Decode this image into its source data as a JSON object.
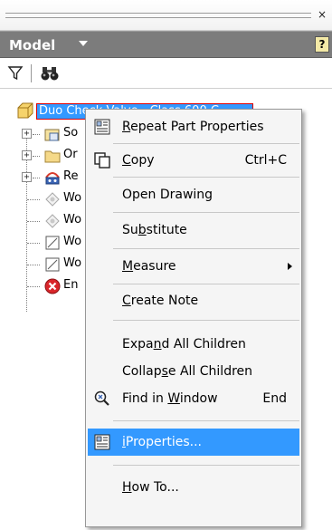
{
  "panel": {
    "close_glyph": "×",
    "title": "Model",
    "help_glyph": "?"
  },
  "toolbar": {
    "filter_icon": "filter-icon",
    "find_icon": "binoculars-icon"
  },
  "tree": {
    "root_label": "Duo Check Valve - Class 600 C",
    "items": [
      {
        "label": "So",
        "icon": "solid-bodies-icon",
        "expandable": true
      },
      {
        "label": "Or",
        "icon": "origin-folder-icon",
        "expandable": true
      },
      {
        "label": "Re",
        "icon": "representations-icon",
        "expandable": true
      },
      {
        "label": "Wo",
        "icon": "work-point-icon",
        "expandable": false
      },
      {
        "label": "Wo",
        "icon": "work-point-icon",
        "expandable": false
      },
      {
        "label": "Wo",
        "icon": "work-plane-icon",
        "expandable": false
      },
      {
        "label": "Wo",
        "icon": "work-plane-icon",
        "expandable": false
      },
      {
        "label": "En",
        "icon": "end-of-part-icon",
        "expandable": false
      }
    ]
  },
  "context_menu": {
    "repeat_part_properties": {
      "pre": "",
      "u": "R",
      "post": "epeat Part Properties"
    },
    "copy": {
      "pre": "",
      "u": "C",
      "post": "opy",
      "shortcut": "Ctrl+C"
    },
    "open_drawing": {
      "pre": "Open Drawing",
      "u": "",
      "post": ""
    },
    "substitute": {
      "pre": "Su",
      "u": "b",
      "post": "stitute"
    },
    "measure": {
      "pre": "",
      "u": "M",
      "post": "easure"
    },
    "create_note": {
      "pre": "",
      "u": "C",
      "post": "reate Note"
    },
    "expand_all": {
      "pre": "Expa",
      "u": "n",
      "post": "d All Children"
    },
    "collapse_all": {
      "pre": "Collap",
      "u": "s",
      "post": "e All Children"
    },
    "find_in_window": {
      "pre": "Find in ",
      "u": "W",
      "post": "indow",
      "shortcut": "End"
    },
    "iproperties": {
      "pre": "",
      "u": "i",
      "post": "Properties..."
    },
    "how_to": {
      "pre": "",
      "u": "H",
      "post": "ow To..."
    }
  },
  "colors": {
    "highlight": "#3399ff",
    "header_bg": "#7c7c7c",
    "root_outline": "#e00000"
  }
}
